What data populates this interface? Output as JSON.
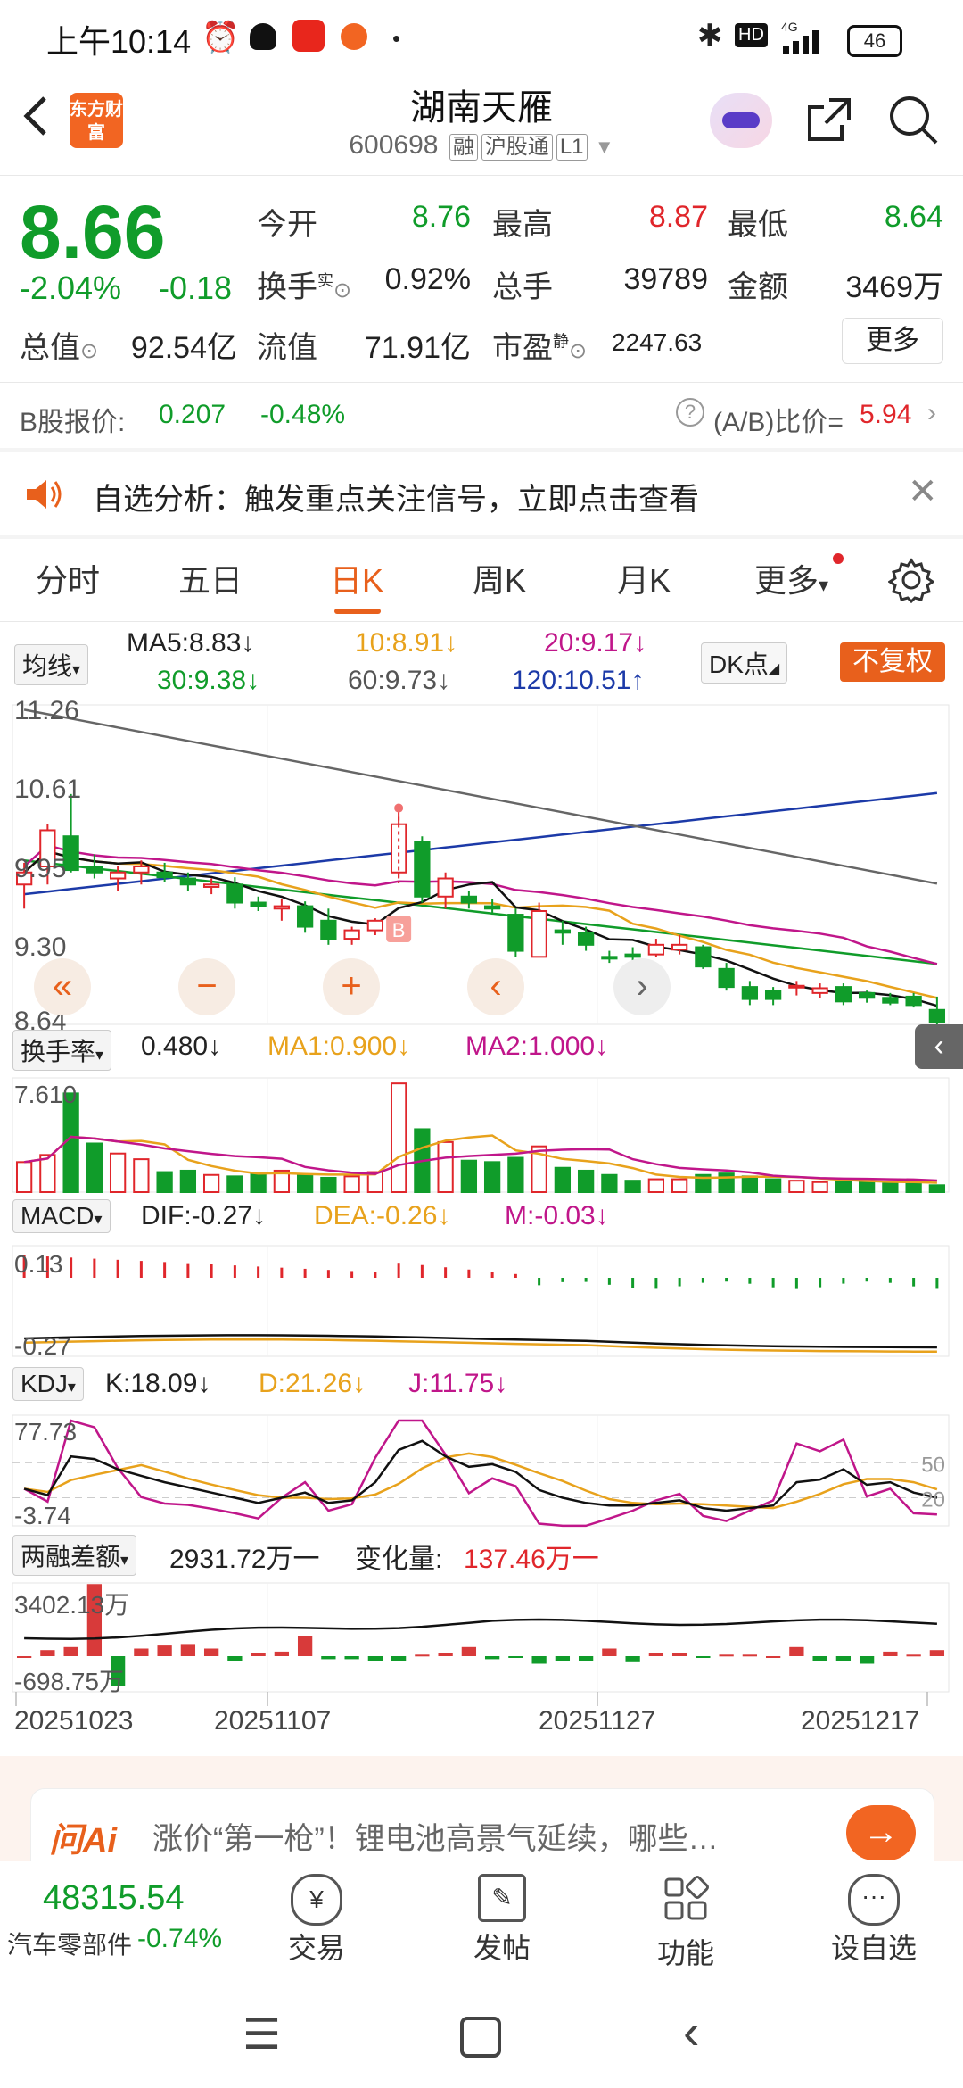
{
  "status_bar": {
    "time": "上午10:14",
    "network": "4G",
    "hd": "HD",
    "battery": "46"
  },
  "header": {
    "logo_text": "东方财富",
    "title": "湖南天雁",
    "code": "600698",
    "tags": [
      "融",
      "沪股通",
      "L1"
    ]
  },
  "quote": {
    "price": "8.66",
    "change_pct": "-2.04%",
    "change": "-0.18",
    "fields": [
      {
        "label": "今开",
        "value": "8.76",
        "color": "#109c2a"
      },
      {
        "label": "最高",
        "value": "8.87",
        "color": "#e0262b"
      },
      {
        "label": "最低",
        "value": "8.64",
        "color": "#109c2a"
      },
      {
        "label": "换手",
        "sup": "实",
        "value": "0.92%",
        "color": "#222"
      },
      {
        "label": "总手",
        "value": "39789",
        "color": "#222"
      },
      {
        "label": "金额",
        "value": "3469万",
        "color": "#222"
      },
      {
        "label": "总值",
        "value": "92.54亿",
        "color": "#222"
      },
      {
        "label": "流值",
        "value": "71.91亿",
        "color": "#222"
      },
      {
        "label": "市盈",
        "sup": "静",
        "value": "2247.63",
        "color": "#222"
      }
    ],
    "more_label": "更多"
  },
  "b_share": {
    "label": "B股报价:",
    "price": "0.207",
    "pct": "-0.48%",
    "ratio_label": "(A/B)比价=",
    "ratio": "5.94"
  },
  "notice": {
    "text": "自选分析：触发重点关注信号，立即点击查看"
  },
  "tabs": [
    "分时",
    "五日",
    "日K",
    "周K",
    "月K",
    "更多"
  ],
  "active_tab": "日K",
  "ma_bar": {
    "selector": "均线",
    "ma5": "MA5:8.83",
    "ma10": "10:8.91",
    "ma20": "20:9.17",
    "ma30": "30:9.38",
    "ma60": "60:9.73",
    "ma120": "120:10.51",
    "dk_label": "DK点",
    "restore_label": "不复权"
  },
  "kline": {
    "y_labels": [
      "11.26",
      "10.61",
      "9.95",
      "9.30",
      "8.64"
    ],
    "b_marker": "B"
  },
  "turnover": {
    "selector": "换手率",
    "value": "0.480",
    "ma1": "MA1:0.900",
    "ma2": "MA2:1.000",
    "y_max": "7.610"
  },
  "macd": {
    "selector": "MACD",
    "dif": "DIF:-0.27",
    "dea": "DEA:-0.26",
    "m": "M:-0.03",
    "y_top": "0.13",
    "y_bottom": "-0.27"
  },
  "kdj": {
    "selector": "KDJ",
    "k": "K:18.09",
    "d": "D:21.26",
    "j": "J:11.75",
    "y_top": "77.73",
    "y_bottom": "-3.74",
    "ref_high": "50",
    "ref_low": "20"
  },
  "margin": {
    "selector": "两融差额",
    "value": "2931.72万一",
    "change_label": "变化量:",
    "change": "137.46万一",
    "y_top": "3402.13万",
    "y_bottom": "-698.75万"
  },
  "dates": [
    "20251023",
    "20251107",
    "20251127",
    "20251217"
  ],
  "ai_prompt": {
    "brand": "问Ai",
    "text": "涨价“第一枪”！锂电池高景气延续，哪些…"
  },
  "bottom_nav": {
    "index_value": "48315.54",
    "index_name": "汽车零部件",
    "index_pct": "-0.74%",
    "items": [
      "交易",
      "发帖",
      "功能",
      "设自选"
    ]
  },
  "chart_data": {
    "type": "candlestick",
    "price_range": [
      8.64,
      11.26
    ],
    "ma_legend": [
      "MA5",
      "MA10",
      "MA20",
      "MA30",
      "MA60",
      "MA120"
    ],
    "candles_approx": [
      {
        "o": 9.8,
        "h": 9.98,
        "l": 9.6,
        "c": 9.9,
        "dir": "up"
      },
      {
        "o": 9.95,
        "h": 10.3,
        "l": 9.8,
        "c": 10.25,
        "dir": "up"
      },
      {
        "o": 10.2,
        "h": 10.55,
        "l": 9.9,
        "c": 9.92,
        "dir": "down"
      },
      {
        "o": 9.95,
        "h": 10.05,
        "l": 9.85,
        "c": 9.9,
        "dir": "down"
      },
      {
        "o": 9.85,
        "h": 9.95,
        "l": 9.75,
        "c": 9.9,
        "dir": "up"
      },
      {
        "o": 9.9,
        "h": 10.0,
        "l": 9.8,
        "c": 9.95,
        "dir": "up"
      },
      {
        "o": 9.9,
        "h": 9.98,
        "l": 9.82,
        "c": 9.86,
        "dir": "down"
      },
      {
        "o": 9.85,
        "h": 9.9,
        "l": 9.75,
        "c": 9.8,
        "dir": "down"
      },
      {
        "o": 9.78,
        "h": 9.85,
        "l": 9.72,
        "c": 9.8,
        "dir": "up"
      },
      {
        "o": 9.8,
        "h": 9.86,
        "l": 9.6,
        "c": 9.65,
        "dir": "down"
      },
      {
        "o": 9.65,
        "h": 9.7,
        "l": 9.58,
        "c": 9.62,
        "dir": "down"
      },
      {
        "o": 9.6,
        "h": 9.68,
        "l": 9.5,
        "c": 9.62,
        "dir": "up"
      },
      {
        "o": 9.62,
        "h": 9.66,
        "l": 9.4,
        "c": 9.45,
        "dir": "down"
      },
      {
        "o": 9.5,
        "h": 9.6,
        "l": 9.3,
        "c": 9.35,
        "dir": "down"
      },
      {
        "o": 9.35,
        "h": 9.45,
        "l": 9.3,
        "c": 9.42,
        "dir": "up"
      },
      {
        "o": 9.42,
        "h": 9.52,
        "l": 9.38,
        "c": 9.5,
        "dir": "up"
      },
      {
        "o": 9.9,
        "h": 10.39,
        "l": 9.85,
        "c": 10.3,
        "dir": "up"
      },
      {
        "o": 10.15,
        "h": 10.2,
        "l": 9.65,
        "c": 9.7,
        "dir": "down"
      },
      {
        "o": 9.7,
        "h": 9.9,
        "l": 9.6,
        "c": 9.85,
        "dir": "up"
      },
      {
        "o": 9.7,
        "h": 9.75,
        "l": 9.6,
        "c": 9.65,
        "dir": "down"
      },
      {
        "o": 9.62,
        "h": 9.68,
        "l": 9.55,
        "c": 9.6,
        "dir": "down"
      },
      {
        "o": 9.55,
        "h": 9.6,
        "l": 9.2,
        "c": 9.25,
        "dir": "down"
      },
      {
        "o": 9.2,
        "h": 9.65,
        "l": 9.2,
        "c": 9.58,
        "dir": "up"
      },
      {
        "o": 9.42,
        "h": 9.5,
        "l": 9.3,
        "c": 9.4,
        "dir": "down"
      },
      {
        "o": 9.4,
        "h": 9.45,
        "l": 9.25,
        "c": 9.3,
        "dir": "down"
      },
      {
        "o": 9.2,
        "h": 9.25,
        "l": 9.15,
        "c": 9.2,
        "dir": "down"
      },
      {
        "o": 9.2,
        "h": 9.28,
        "l": 9.15,
        "c": 9.22,
        "dir": "down"
      },
      {
        "o": 9.22,
        "h": 9.35,
        "l": 9.2,
        "c": 9.3,
        "dir": "up"
      },
      {
        "o": 9.3,
        "h": 9.38,
        "l": 9.22,
        "c": 9.26,
        "dir": "up"
      },
      {
        "o": 9.28,
        "h": 9.3,
        "l": 9.1,
        "c": 9.12,
        "dir": "down"
      },
      {
        "o": 9.1,
        "h": 9.15,
        "l": 8.92,
        "c": 8.95,
        "dir": "down"
      },
      {
        "o": 8.95,
        "h": 9.0,
        "l": 8.8,
        "c": 8.85,
        "dir": "down"
      },
      {
        "o": 8.85,
        "h": 8.95,
        "l": 8.8,
        "c": 8.92,
        "dir": "down"
      },
      {
        "o": 8.95,
        "h": 9.0,
        "l": 8.88,
        "c": 8.96,
        "dir": "up"
      },
      {
        "o": 8.9,
        "h": 8.98,
        "l": 8.86,
        "c": 8.94,
        "dir": "up"
      },
      {
        "o": 8.95,
        "h": 8.98,
        "l": 8.8,
        "c": 8.83,
        "dir": "down"
      },
      {
        "o": 8.9,
        "h": 8.92,
        "l": 8.82,
        "c": 8.86,
        "dir": "down"
      },
      {
        "o": 8.86,
        "h": 8.9,
        "l": 8.8,
        "c": 8.82,
        "dir": "down"
      },
      {
        "o": 8.87,
        "h": 8.9,
        "l": 8.78,
        "c": 8.8,
        "dir": "down"
      },
      {
        "o": 8.76,
        "h": 8.87,
        "l": 8.64,
        "c": 8.66,
        "dir": "down"
      }
    ]
  }
}
